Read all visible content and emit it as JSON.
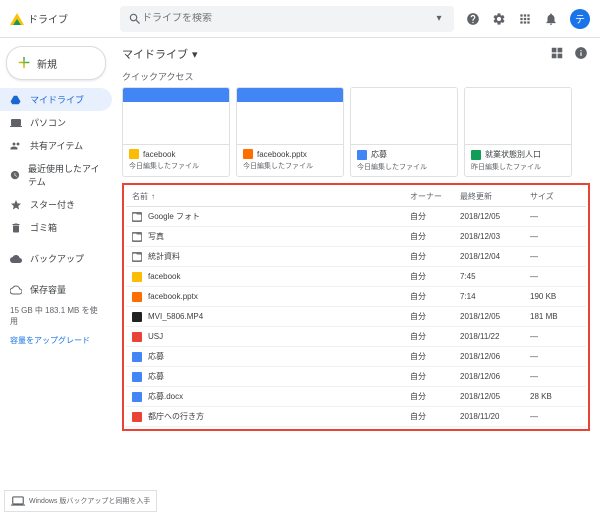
{
  "header": {
    "product": "ドライブ",
    "search_placeholder": "ドライブを検索",
    "avatar_letter": "テ"
  },
  "sidebar": {
    "new_label": "新規",
    "items": [
      {
        "label": "マイドライブ",
        "icon": "drive"
      },
      {
        "label": "パソコン",
        "icon": "computer"
      },
      {
        "label": "共有アイテム",
        "icon": "people"
      },
      {
        "label": "最近使用したアイテム",
        "icon": "clock"
      },
      {
        "label": "スター付き",
        "icon": "star"
      },
      {
        "label": "ゴミ箱",
        "icon": "trash"
      }
    ],
    "backup": "バックアップ",
    "storage_label": "保存容量",
    "storage_used": "15 GB 中 183.1 MB を使用",
    "storage_upgrade": "容量をアップグレード"
  },
  "main": {
    "breadcrumb": "マイドライブ",
    "quick_access": "クイックアクセス",
    "qa": [
      {
        "name": "facebook",
        "sub": "今日編集したファイル",
        "iconClass": "f-yellow",
        "thumb": "blue"
      },
      {
        "name": "facebook.pptx",
        "sub": "今日編集したファイル",
        "iconClass": "f-orange",
        "thumb": "blue"
      },
      {
        "name": "応募",
        "sub": "今日編集したファイル",
        "iconClass": "f-blue",
        "thumb": "doc"
      },
      {
        "name": "就業状態別人口",
        "sub": "昨日編集したファイル",
        "iconClass": "f-green",
        "thumb": "sheet"
      }
    ],
    "columns": {
      "name": "名前",
      "owner": "オーナー",
      "modified": "最終更新",
      "size": "サイズ"
    },
    "rows": [
      {
        "icon": "f-gray",
        "name": "Google フォト",
        "owner": "自分",
        "mod": "2018/12/05",
        "size": "—"
      },
      {
        "icon": "f-gray",
        "name": "写真",
        "owner": "自分",
        "mod": "2018/12/03",
        "size": "—"
      },
      {
        "icon": "f-gray",
        "name": "統計資料",
        "owner": "自分",
        "mod": "2018/12/04",
        "size": "—"
      },
      {
        "icon": "f-yellow",
        "name": "facebook",
        "owner": "自分",
        "mod": "7:45",
        "size": "—"
      },
      {
        "icon": "f-orange",
        "name": "facebook.pptx",
        "owner": "自分",
        "mod": "7:14",
        "size": "190 KB"
      },
      {
        "icon": "f-dark",
        "name": "MVI_5806.MP4",
        "owner": "自分",
        "mod": "2018/12/05",
        "size": "181 MB"
      },
      {
        "icon": "f-red",
        "name": "USJ",
        "owner": "自分",
        "mod": "2018/11/22",
        "size": "—"
      },
      {
        "icon": "f-blue",
        "name": "応募",
        "owner": "自分",
        "mod": "2018/12/06",
        "size": "—"
      },
      {
        "icon": "f-blue",
        "name": "応募",
        "owner": "自分",
        "mod": "2018/12/06",
        "size": "—"
      },
      {
        "icon": "f-blue",
        "name": "応募.docx",
        "owner": "自分",
        "mod": "2018/12/05",
        "size": "28 KB"
      },
      {
        "icon": "f-red",
        "name": "都庁への行き方",
        "owner": "自分",
        "mod": "2018/11/20",
        "size": "—"
      }
    ]
  },
  "promo": "Windows 版バックアップと同期を入手"
}
